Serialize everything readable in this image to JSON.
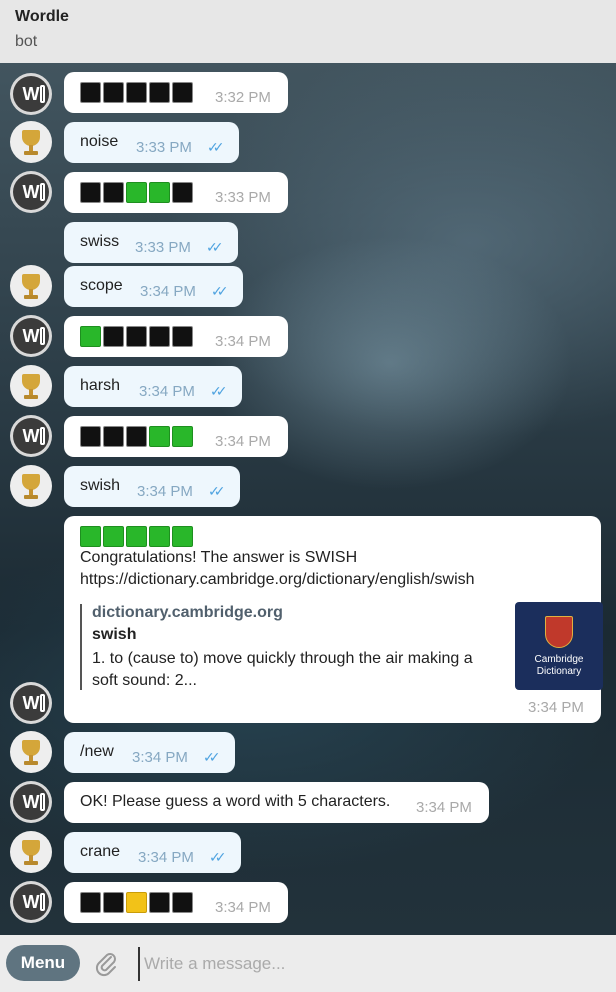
{
  "header": {
    "title": "Wordle",
    "subtitle": "bot"
  },
  "colors": {
    "green": "#29b72a",
    "yellow": "#f2c218",
    "black": "#111111",
    "accent": "#4fa3e0"
  },
  "messages": [
    {
      "from": "bot",
      "tiles": [
        "black",
        "black",
        "black",
        "black",
        "black"
      ],
      "time": "3:32 PM"
    },
    {
      "from": "me",
      "text": "noise",
      "time": "3:33 PM"
    },
    {
      "from": "bot",
      "tiles": [
        "black",
        "black",
        "green",
        "green",
        "black"
      ],
      "time": "3:33 PM"
    },
    {
      "from": "me",
      "text": "swiss",
      "time": "3:33 PM"
    },
    {
      "from": "me",
      "text": "scope",
      "time": "3:34 PM"
    },
    {
      "from": "bot",
      "tiles": [
        "green",
        "black",
        "black",
        "black",
        "black"
      ],
      "time": "3:34 PM"
    },
    {
      "from": "me",
      "text": "harsh",
      "time": "3:34 PM"
    },
    {
      "from": "bot",
      "tiles": [
        "black",
        "black",
        "black",
        "green",
        "green"
      ],
      "time": "3:34 PM"
    },
    {
      "from": "me",
      "text": "swish",
      "time": "3:34 PM"
    },
    {
      "from": "bot",
      "tiles": [
        "green",
        "green",
        "green",
        "green",
        "green"
      ],
      "text": "Congratulations! The answer is SWISH",
      "link": "https://dictionary.cambridge.org/dictionary/english/swish",
      "preview": {
        "site": "dictionary.cambridge.org",
        "title": "swish",
        "description": "1. to (cause to) move quickly through the air making a soft sound:  2...",
        "thumb_line1": "Cambridge",
        "thumb_line2": "Dictionary"
      },
      "time": "3:34 PM"
    },
    {
      "from": "me",
      "text": "/new",
      "time": "3:34 PM"
    },
    {
      "from": "bot",
      "text": "OK! Please guess a word with 5 characters.",
      "time": "3:34 PM"
    },
    {
      "from": "me",
      "text": "crane",
      "time": "3:34 PM"
    },
    {
      "from": "bot",
      "tiles": [
        "black",
        "black",
        "yellow",
        "black",
        "black"
      ],
      "time": "3:34 PM"
    }
  ],
  "input": {
    "menu_label": "Menu",
    "placeholder": "Write a message..."
  }
}
